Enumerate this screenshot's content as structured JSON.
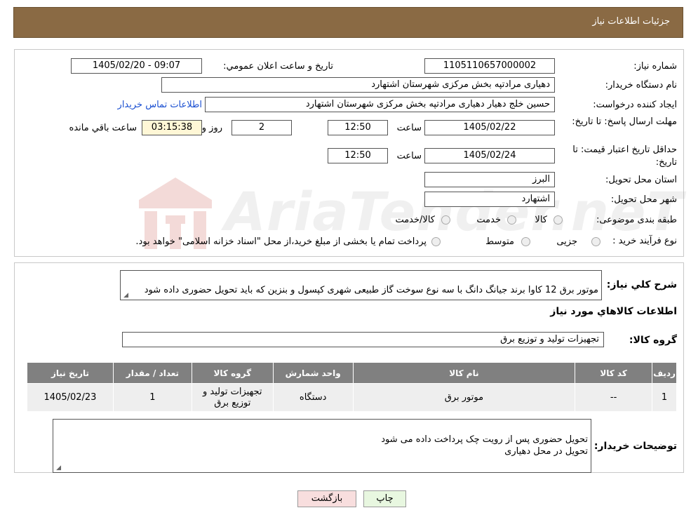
{
  "header": {
    "title": "جزئيات اطلاعات نياز"
  },
  "form": {
    "need_number_label": "شماره نياز:",
    "need_number": "1105110657000002",
    "announce_label": "تاريخ و ساعت اعلان عمومي:",
    "announce_value": "1405/02/20 - 09:07",
    "buyer_org_label": "نام دستگاه خريدار:",
    "buyer_org": "دهیاری مرادتپه بخش مرکزی شهرستان اشتهارد",
    "requester_label": "ايجاد کننده درخواست:",
    "requester": "حسین خلج دهیار دهیاری مرادتپه بخش مرکزی شهرستان اشتهارد",
    "contact_link": "اطلاعات تماس خريدار",
    "send_deadline_label": "مهلت ارسال پاسخ: تا تاريخ:",
    "send_deadline_date": "1405/02/22",
    "time_label": "ساعت",
    "send_deadline_time": "12:50",
    "days_value": "2",
    "days_label": "روز و",
    "remaining_time": "03:15:38",
    "remaining_label": "ساعت باقي مانده",
    "price_validity_label": "حداقل تاريخ اعتبار قيمت: تا تاريخ:",
    "price_validity_date": "1405/02/24",
    "price_validity_time": "12:50",
    "province_label": "استان محل تحويل:",
    "province": "البرز",
    "city_label": "شهر محل تحويل:",
    "city": "اشتهارد",
    "category_label": "طبقه بندی موضوعی:",
    "category_options": [
      "کالا",
      "خدمت",
      "کالا/خدمت"
    ],
    "process_label": "نوع فرآيند خريد :",
    "process_options": [
      "جزیی",
      "متوسط"
    ],
    "process_note": "پرداخت تمام یا بخشی از مبلغ خرید،از محل \"اسناد خزانه اسلامی\" خواهد بود."
  },
  "details": {
    "summary_label": "شرح کلي نياز:",
    "summary": "موتور برق 12 کاوا برند جیانگ دانگ با سه نوع سوخت گاز طبیعی شهری کپسول و بنزین که باید تحویل حضوری داده شود",
    "goods_info_title": "اطلاعات کالاهاي مورد نياز",
    "goods_group_label": "گروه کالا:",
    "goods_group": "تجهیزات تولید و توزیع برق"
  },
  "table": {
    "headers": [
      "رديف",
      "کد کالا",
      "نام کالا",
      "واحد شمارش",
      "گروه کالا",
      "تعداد / مقدار",
      "تاريخ نياز"
    ],
    "rows": [
      [
        "1",
        "--",
        "موتور برق",
        "دستگاه",
        "تجهیزات تولید و توزیع برق",
        "1",
        "1405/02/23"
      ]
    ]
  },
  "buyer_notes": {
    "label": "توضيحات خريدار:",
    "text": "تحویل حضوری پس از رویت چک پرداخت داده می شود\nتحویل در محل دهیاری"
  },
  "buttons": {
    "print": "چاپ",
    "back": "بازگشت"
  },
  "watermark": {
    "text": "AriaTender.neT"
  },
  "colors": {
    "header_bg": "#8a6a44",
    "table_header_bg": "#808080",
    "link": "#1a4fd1",
    "back_btn": "#f8dede",
    "print_btn": "#e8f7e0"
  }
}
